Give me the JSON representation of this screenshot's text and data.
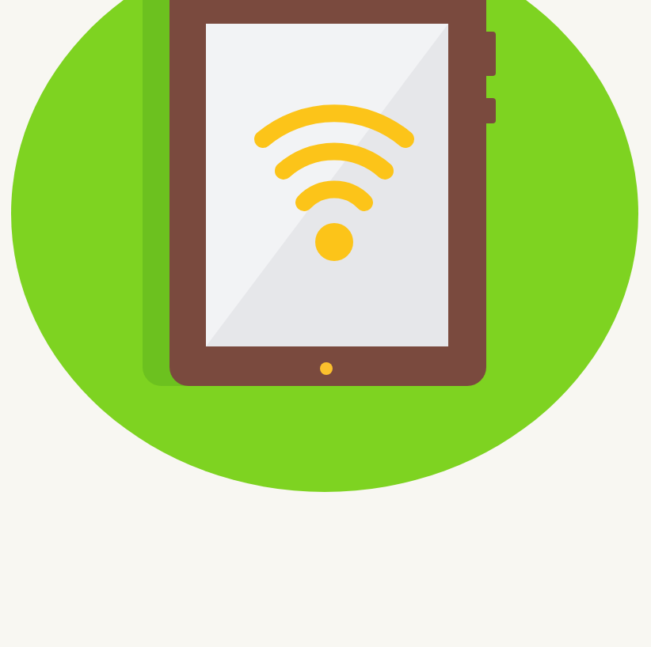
{
  "illustration": {
    "kind": "tablet-wifi"
  }
}
